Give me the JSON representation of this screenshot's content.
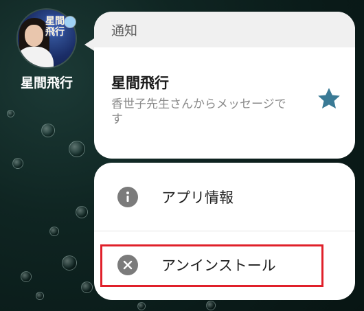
{
  "app": {
    "name": "星間飛行",
    "icon_title": "星間\n飛行",
    "icon_name": "app-avatar-icon",
    "has_badge": true
  },
  "notification": {
    "header": "通知",
    "title": "星間飛行",
    "message": "香世子先生さんからメッセージです",
    "star_icon": "star-icon",
    "star_color": "#3a7a95"
  },
  "actions": [
    {
      "label": "アプリ情報",
      "icon": "info-icon"
    },
    {
      "label": "アンインストール",
      "icon": "uninstall-icon"
    }
  ],
  "highlight": {
    "target": "アンインストール",
    "color": "#e0202a"
  },
  "colors": {
    "background": "#0f2522",
    "card": "#ffffff",
    "header": "#f0f0f0",
    "icon_gray": "#7b7b7b"
  }
}
